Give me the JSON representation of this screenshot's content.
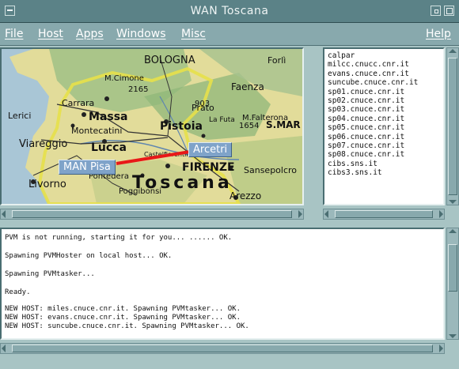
{
  "window": {
    "title": "WAN Toscana"
  },
  "menu": [
    "File",
    "Host",
    "Apps",
    "Windows",
    "Misc"
  ],
  "help_label": "Help",
  "map": {
    "labels": [
      "Carrara",
      "Massa",
      "Montecatini",
      "Pistoia",
      "Viareggio",
      "Lucca",
      "Livorno",
      "Pontedera",
      "Poggibonsi",
      "FIRENZE",
      "Toscana",
      "Arezzo",
      "Sansepolcro",
      "BOLOGNA",
      "Faenza",
      "Lerici",
      "Prato",
      "S.MAR",
      "M.Falterona",
      "M.Cimone",
      "La Futa",
      "Castelfiorentino",
      "Forlì",
      "903",
      "1654",
      "2165"
    ],
    "nodes": {
      "left": "MAN Pisa",
      "right": "Arcetri"
    },
    "link_color": "#e81818"
  },
  "hosts": [
    "calpar",
    "milcc.cnucc.cnr.it",
    "evans.cnuce.cnr.it",
    "suncube.cnuce.cnr.it",
    "sp01.cnuce.cnr.it",
    "sp02.cnuce.cnr.it",
    "sp03.cnuce.cnr.it",
    "sp04.cnuce.cnr.it",
    "sp05.cnuce.cnr.it",
    "sp06.cnuce.cnr.it",
    "sp07.cnuce.cnr.it",
    "sp08.cnuce.cnr.it",
    "cibs.sns.it",
    "cibs3.sns.it"
  ],
  "console": [
    "PVM is not running, starting it for you... ...... OK.",
    "Spawning PVMHoster on local host... OK.",
    "Spawning PVMtasker...",
    "Ready.",
    "NEW HOST: miles.cnuce.cnr.it. Spawning PVMtasker... OK.",
    "NEW HOST: evans.cnuce.cnr.it. Spawning PVMtasker... OK.",
    "NEW HOST: suncube.cnuce.cnr.it. Spawning PVMtasker... OK."
  ]
}
